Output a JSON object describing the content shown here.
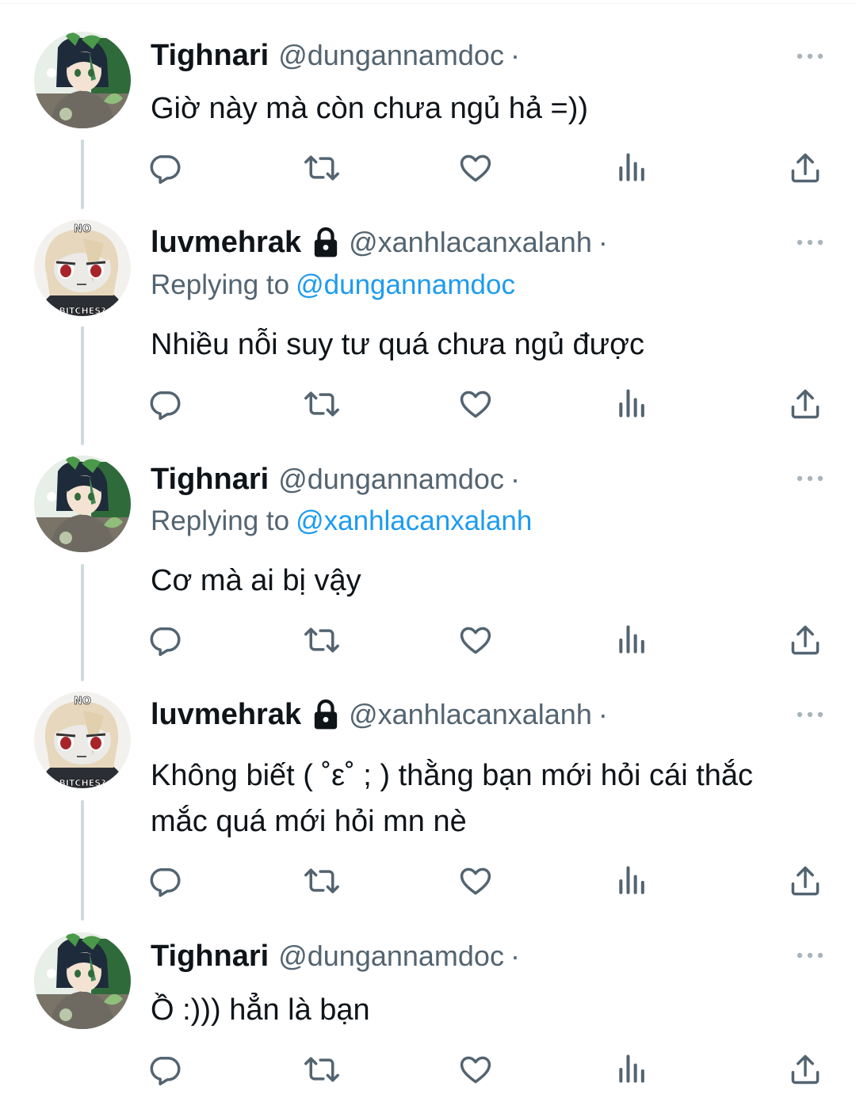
{
  "tweets": [
    {
      "name": "Tighnari",
      "handle": "@dungannamdoc",
      "separator": "·",
      "locked": false,
      "replying_label": "",
      "replying_to": "",
      "text": "Giờ này mà còn chưa ngủ hả =))"
    },
    {
      "name": "luvmehrak",
      "handle": "@xanhlacanxalanh",
      "separator": "·",
      "locked": true,
      "replying_label": "Replying to",
      "replying_to": "@dungannamdoc",
      "text": "Nhiều nỗi suy tư quá chưa ngủ được"
    },
    {
      "name": "Tighnari",
      "handle": "@dungannamdoc",
      "separator": "·",
      "locked": false,
      "replying_label": "Replying to",
      "replying_to": "@xanhlacanxalanh",
      "text": "Cơ mà ai bị vậy"
    },
    {
      "name": "luvmehrak",
      "handle": "@xanhlacanxalanh",
      "separator": "·",
      "locked": true,
      "replying_label": "",
      "replying_to": "",
      "text": "Không biết ( ˚ε˚ ;  ) thằng bạn mới hỏi cái thắc mắc quá mới hỏi mn nè"
    },
    {
      "name": "Tighnari",
      "handle": "@dungannamdoc",
      "separator": "·",
      "locked": false,
      "replying_label": "",
      "replying_to": "",
      "text": "Ồ :))) hẳn là bạn"
    }
  ],
  "avatar_text": {
    "top": "NO",
    "bottom": "BITCHES?"
  },
  "colors": {
    "text": "#0f1419",
    "secondary": "#536471",
    "link": "#1d9bf0",
    "thread_line": "#cfd9de",
    "icon": "#536471"
  },
  "icons": [
    "reply-icon",
    "retweet-icon",
    "like-icon",
    "views-icon",
    "share-icon",
    "more-icon",
    "lock-icon"
  ]
}
